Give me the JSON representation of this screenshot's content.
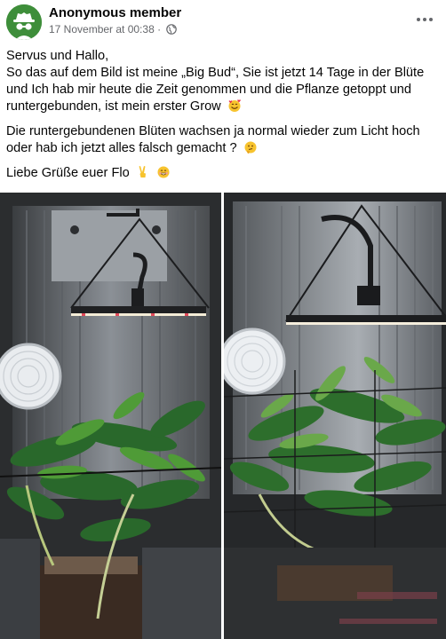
{
  "post": {
    "author": "Anonymous member",
    "timestamp": "17 November at 00:38",
    "separator": "·",
    "audience_icon": "public-icon",
    "more_icon": "more-options-icon",
    "lines": {
      "greeting": "Servus und Hallo,",
      "para1": "So das auf dem Bild ist meine „Big Bud“, Sie ist jetzt 14 Tage in der Blüte und Ich hab mir heute die Zeit genommen und die Pflanze getoppt und runtergebunden, ist mein erster Grow",
      "para2": "Die runtergebundenen Blüten wachsen ja normal wieder zum Licht hoch oder hab ich jetzt alles falsch gemacht ?",
      "signoff": "Liebe Grüße euer Flo"
    },
    "emojis": [
      "smiling-face-with-hearts",
      "thinking-face",
      "victory-hand",
      "smiling-face"
    ],
    "photos": [
      {
        "icon": "grow-tent-photo-1"
      },
      {
        "icon": "grow-tent-photo-2"
      }
    ],
    "colors": {
      "avatar_bg": "#3e8e3a",
      "meta_text": "#65676b"
    }
  }
}
